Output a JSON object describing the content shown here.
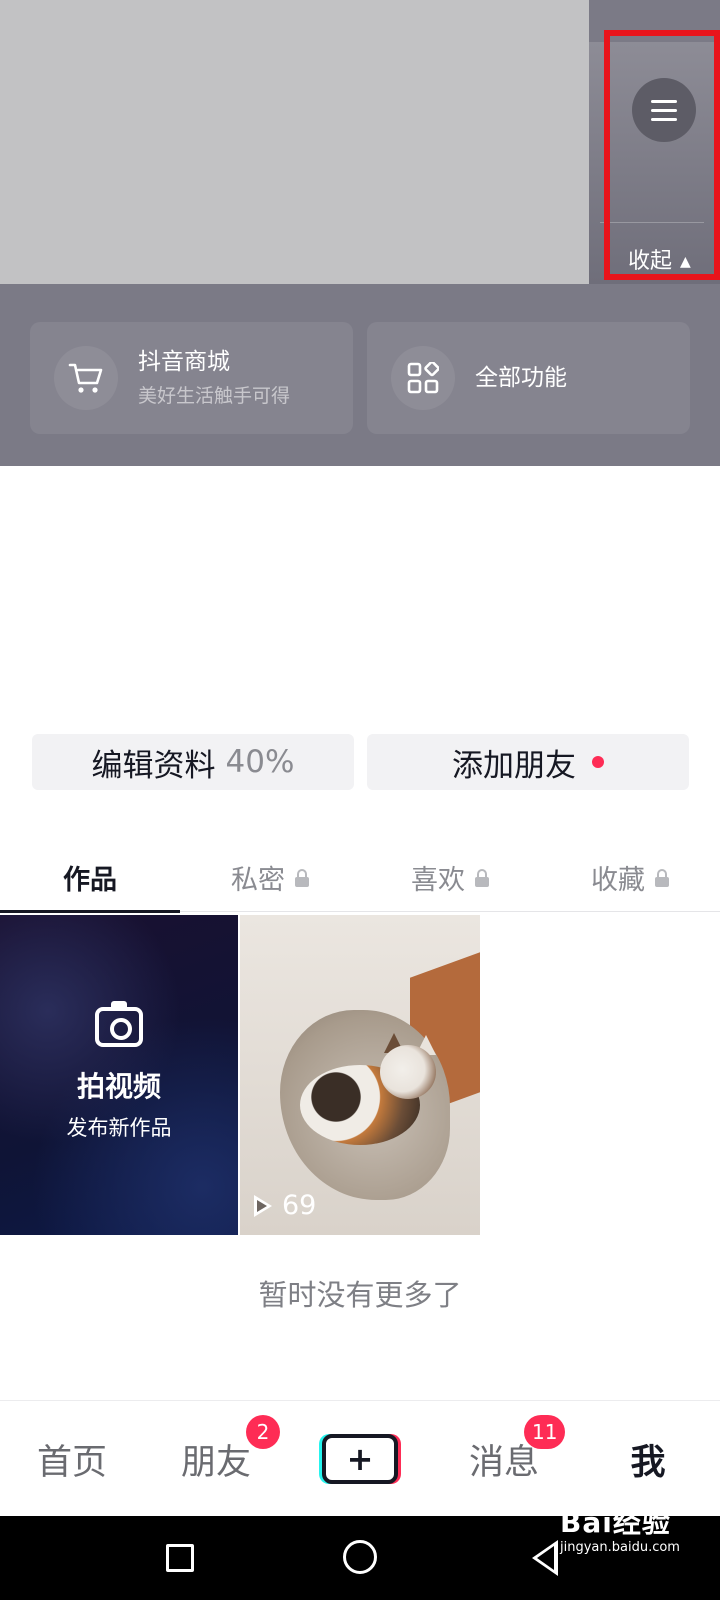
{
  "header": {
    "collapse_label": "收起",
    "menu_icon": "menu-icon",
    "highlight_color": "#e8141b"
  },
  "feature_cards": [
    {
      "title": "抖音商城",
      "subtitle": "美好生活触手可得",
      "icon": "cart-icon"
    },
    {
      "title": "全部功能",
      "subtitle": "",
      "icon": "apps-grid-icon"
    }
  ],
  "profile_actions": {
    "edit_label": "编辑资料",
    "edit_progress": "40%",
    "add_friends_label": "添加朋友"
  },
  "tabs": [
    {
      "label": "作品",
      "active": true,
      "locked": false
    },
    {
      "label": "私密",
      "active": false,
      "locked": true
    },
    {
      "label": "喜欢",
      "active": false,
      "locked": true
    },
    {
      "label": "收藏",
      "active": false,
      "locked": true
    }
  ],
  "grid": {
    "shoot_title": "拍视频",
    "shoot_subtitle": "发布新作品",
    "video_play_count": "69"
  },
  "no_more_text": "暂时没有更多了",
  "bottom_nav": {
    "home": "首页",
    "friends": "朋友",
    "friends_badge": "2",
    "create": "+",
    "messages": "消息",
    "messages_badge": "11",
    "me": "我"
  },
  "watermark": {
    "brand": "Bai经验",
    "url": "jingyan.baidu.com"
  },
  "colors": {
    "accent_red": "#fe2c55",
    "accent_cyan": "#25f4ee",
    "top_background": "#7b7a86"
  }
}
